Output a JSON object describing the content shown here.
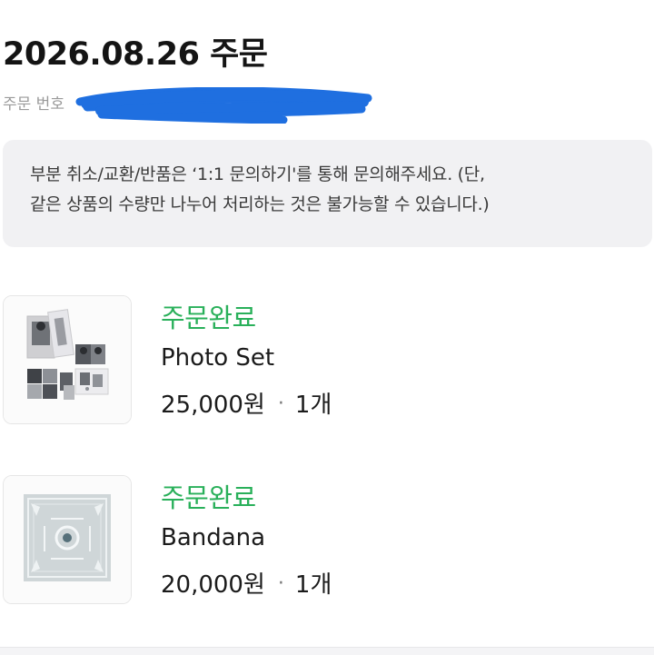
{
  "header": {
    "order_title": "2026.08.26 주문",
    "order_number_label": "주문 번호"
  },
  "notice": {
    "line1": "부분 취소/교환/반품은 ‘1:1 문의하기'를 통해 문의해주세요. (단,",
    "line2": "같은 상품의 수량만 나누어 처리하는 것은 불가능할 수 있습니다.)"
  },
  "items": [
    {
      "status": "주문완료",
      "name": "Photo Set",
      "price": "25,000원",
      "separator": "·",
      "quantity": "1개",
      "thumbnail_icon": "photo-set-image"
    },
    {
      "status": "주문완료",
      "name": "Bandana",
      "price": "20,000원",
      "separator": "·",
      "quantity": "1개",
      "thumbnail_icon": "bandana-image"
    }
  ],
  "colors": {
    "status_green": "#29b05a",
    "notice_bg": "#f1f1f3",
    "redaction_blue": "#1f6fe0"
  }
}
